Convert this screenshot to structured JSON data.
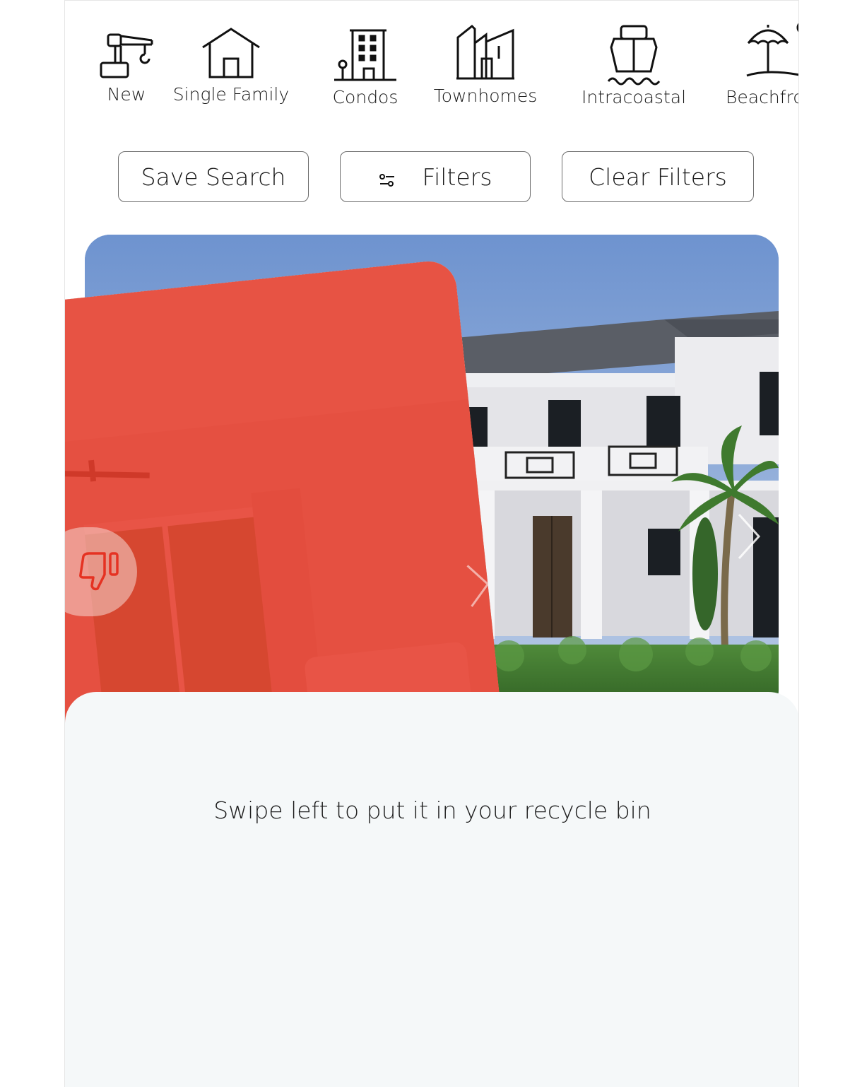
{
  "categories": [
    {
      "label": "New",
      "icon": "crane-icon"
    },
    {
      "label": "Single Family",
      "icon": "house-icon"
    },
    {
      "label": "Condos",
      "icon": "condo-building-icon"
    },
    {
      "label": "Townhomes",
      "icon": "townhomes-icon"
    },
    {
      "label": "Intracoastal",
      "icon": "ship-icon"
    },
    {
      "label": "Beachfro",
      "icon": "beach-umbrella-icon"
    }
  ],
  "actions": {
    "save_search": "Save Search",
    "filters": "Filters",
    "clear_filters": "Clear Filters"
  },
  "swipe_overlay": {
    "color": "#e53222",
    "action_icon": "thumbs-down-icon"
  },
  "hint_text": "Swipe left to put it in your recycle bin"
}
